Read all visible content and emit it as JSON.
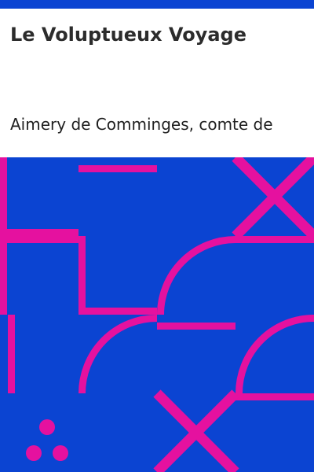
{
  "book": {
    "title": "Le Voluptueux Voyage",
    "author": "Aimery de Comminges, comte de"
  },
  "colors": {
    "accent_bar": "#0b44d2",
    "pattern_background": "#0b44d2",
    "pattern_lines": "#e5119f",
    "title_text": "#2c2c2c",
    "author_text": "#1f1f1f"
  }
}
